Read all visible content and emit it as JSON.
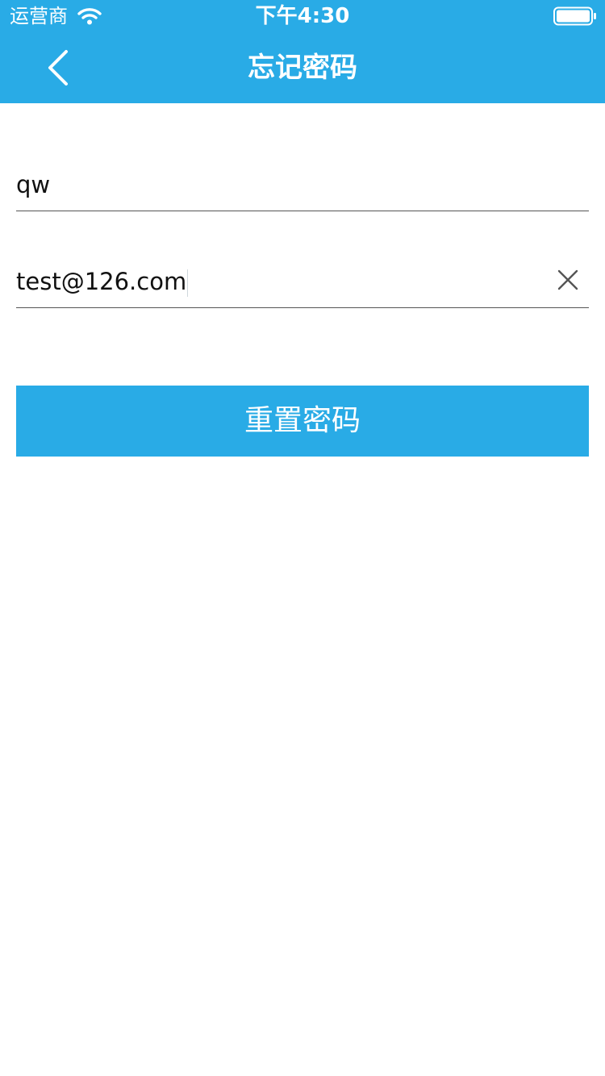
{
  "status_bar": {
    "carrier": "运营商",
    "time": "下午4:30",
    "wifi_icon": "wifi-icon",
    "battery_icon": "battery-icon"
  },
  "nav": {
    "title": "忘记密码",
    "back_icon": "chevron-left-icon"
  },
  "form": {
    "username_value": "qw",
    "email_value": "test@126.com",
    "clear_icon": "close-icon"
  },
  "actions": {
    "reset_label": "重置密码"
  },
  "colors": {
    "primary": "#29abe6",
    "text": "#111111",
    "divider": "#555555",
    "background": "#ffffff"
  }
}
